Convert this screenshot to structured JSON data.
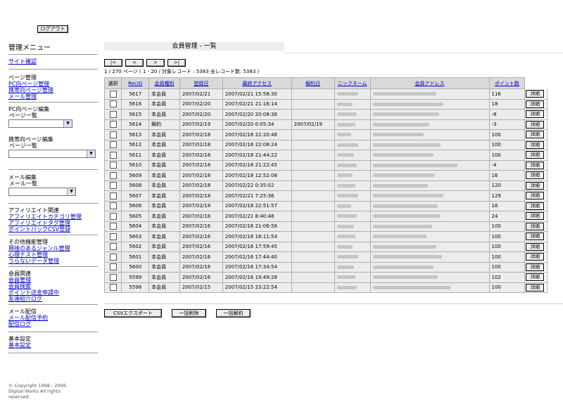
{
  "header": {
    "logout_label": "ログアウト"
  },
  "sidebar": {
    "title": "管理メニュー",
    "site_check": "サイト確認",
    "page_mgmt": {
      "heading": "ページ管理",
      "links": [
        "PC向ページ管理",
        "携帯向ページ管理",
        "メール管理"
      ]
    },
    "pc_edit": {
      "heading": "PC向ページ編集",
      "sub": "ページ一覧"
    },
    "mobile_edit": {
      "heading": "携帯向ページ編集",
      "sub": "ページ一覧"
    },
    "mail_edit": {
      "heading": "メール編集",
      "sub": "メール一覧"
    },
    "affiliate": {
      "heading": "アフィリエイト関連",
      "links": [
        "アフィリエイトカテゴリ管理",
        "アフィリエイトタグ管理",
        "ポイントバックCSV登録"
      ]
    },
    "other": {
      "heading": "その他機能管理",
      "links": [
        "興味のあるジャンル管理",
        "心理テスト管理",
        "うらないデータ管理"
      ]
    },
    "members": {
      "heading": "会員関連",
      "links": [
        "会員管理",
        "会員検索",
        "ポイント送金申請中",
        "友達紹介ログ"
      ]
    },
    "mail_delivery": {
      "heading": "メール配信",
      "links": [
        "メール配信予約",
        "配信ログ"
      ]
    },
    "basic": {
      "heading": "基本設定",
      "links": [
        "基本設定"
      ]
    },
    "copyright": [
      "© Copyright 1998 - 2006.",
      "Digital Works All rights",
      "reserved."
    ]
  },
  "main": {
    "title": "会員管理 - 一覧",
    "pager": [
      "|<",
      "<",
      ">",
      ">|"
    ],
    "count_text": "1 / 270 ページ ( 1 - 20 / 対象レコード : 5383 全レコード数: 5383 )",
    "columns": [
      "選択",
      "RecID",
      "会員種別",
      "登録日",
      "最終アクセス",
      "解約日",
      "ニックネーム",
      "会員アドレス",
      "ポイント数",
      ""
    ],
    "detail_label": "詳細",
    "rows": [
      {
        "id": "5617",
        "type": "本会員",
        "reg": "2007/02/21",
        "last": "2007/02/21 15:58:30",
        "cancel": "",
        "points": "116"
      },
      {
        "id": "5616",
        "type": "本会員",
        "reg": "2007/02/20",
        "last": "2007/02/21 21:16:14",
        "cancel": "",
        "points": "18"
      },
      {
        "id": "5615",
        "type": "本会員",
        "reg": "2007/02/20",
        "last": "2007/02/20 20:08:36",
        "cancel": "",
        "points": "-8"
      },
      {
        "id": "5614",
        "type": "解約",
        "reg": "2007/02/19",
        "last": "2007/02/20 0:05:34",
        "cancel": "2007/02/19",
        "points": "-3"
      },
      {
        "id": "5613",
        "type": "本会員",
        "reg": "2007/02/18",
        "last": "2007/02/18 22:20:48",
        "cancel": "",
        "points": "100"
      },
      {
        "id": "5612",
        "type": "本会員",
        "reg": "2007/02/18",
        "last": "2007/02/18 22:08:24",
        "cancel": "",
        "points": "100"
      },
      {
        "id": "5611",
        "type": "本会員",
        "reg": "2007/02/18",
        "last": "2007/02/18 21:44:22",
        "cancel": "",
        "points": "100"
      },
      {
        "id": "5610",
        "type": "本会員",
        "reg": "2007/02/18",
        "last": "2007/02/18 21:22:45",
        "cancel": "",
        "points": "-4"
      },
      {
        "id": "5609",
        "type": "本会員",
        "reg": "2007/02/18",
        "last": "2007/02/18 12:52:08",
        "cancel": "",
        "points": "16"
      },
      {
        "id": "5608",
        "type": "本会員",
        "reg": "2007/02/18",
        "last": "2007/02/22 0:35:02",
        "cancel": "",
        "points": "120"
      },
      {
        "id": "5607",
        "type": "本会員",
        "reg": "2007/02/18",
        "last": "2007/02/21 7:25:36",
        "cancel": "",
        "points": "129"
      },
      {
        "id": "5606",
        "type": "本会員",
        "reg": "2007/02/18",
        "last": "2007/02/18 22:51:57",
        "cancel": "",
        "points": "16"
      },
      {
        "id": "5605",
        "type": "本会員",
        "reg": "2007/02/18",
        "last": "2007/02/21 8:40:48",
        "cancel": "",
        "points": "24"
      },
      {
        "id": "5604",
        "type": "本会員",
        "reg": "2007/02/16",
        "last": "2007/02/16 21:06:56",
        "cancel": "",
        "points": "100"
      },
      {
        "id": "5603",
        "type": "本会員",
        "reg": "2007/02/16",
        "last": "2007/02/16 18:11:54",
        "cancel": "",
        "points": "100"
      },
      {
        "id": "5602",
        "type": "本会員",
        "reg": "2007/02/16",
        "last": "2007/02/16 17:59:45",
        "cancel": "",
        "points": "100"
      },
      {
        "id": "5601",
        "type": "本会員",
        "reg": "2007/02/16",
        "last": "2007/02/16 17:44:40",
        "cancel": "",
        "points": "100"
      },
      {
        "id": "5600",
        "type": "本会員",
        "reg": "2007/02/16",
        "last": "2007/02/16 17:34:54",
        "cancel": "",
        "points": "100"
      },
      {
        "id": "5599",
        "type": "本会員",
        "reg": "2007/02/16",
        "last": "2007/02/16 19:49:28",
        "cancel": "",
        "points": "102"
      },
      {
        "id": "5598",
        "type": "本会員",
        "reg": "2007/02/15",
        "last": "2007/02/15 23:22:54",
        "cancel": "",
        "points": "100"
      }
    ],
    "actions": [
      "CSVエクスポート",
      "一括削除",
      "一括解約"
    ]
  }
}
